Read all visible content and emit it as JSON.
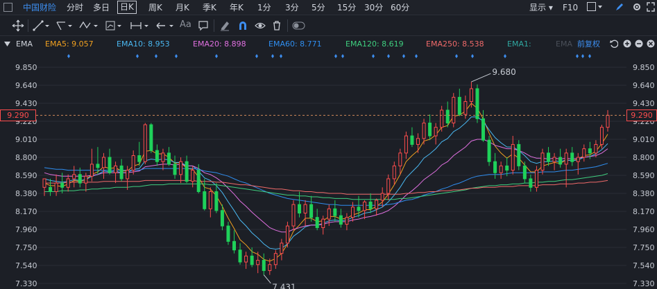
{
  "periods": [
    {
      "label": "中国财险",
      "brand": true
    },
    {
      "label": "分时"
    },
    {
      "label": "多日"
    },
    {
      "label": "日K",
      "active": true
    },
    {
      "label": "周K"
    },
    {
      "label": "月K"
    },
    {
      "label": "季K"
    },
    {
      "label": "年K"
    },
    {
      "label": "1分"
    },
    {
      "label": "3分"
    },
    {
      "label": "5分"
    },
    {
      "label": "15分"
    },
    {
      "label": "30分"
    },
    {
      "label": "60分"
    }
  ],
  "topright": {
    "display": "显示",
    "f10": "F10"
  },
  "toolbar": {
    "text_tool": "Aa"
  },
  "legend": {
    "indicator": "EMA",
    "items": [
      {
        "text": "EMA5: 9.057",
        "color": "#f0a020"
      },
      {
        "text": "EMA10: 8.953",
        "color": "#4ab7f0"
      },
      {
        "text": "EMA20: 8.898",
        "color": "#e070e0"
      },
      {
        "text": "EMA60: 8.771",
        "color": "#2f8ef0"
      },
      {
        "text": "EMA120: 8.619",
        "color": "#3fcf7f"
      },
      {
        "text": "EMA250: 8.538",
        "color": "#f06a6a"
      },
      {
        "text": "EMA1:",
        "color": "#2fa7a0"
      },
      {
        "text": "EMA",
        "color": "#4a4f59"
      }
    ],
    "adjust": "前复权"
  },
  "colors": {
    "up": "#ff4d4d",
    "down": "#1fd15a",
    "grid": "#2a2e37",
    "axis_text": "#c8ccd4",
    "cursor": "#ff4d4d"
  },
  "chart_data": {
    "type": "candlestick",
    "yticks": [
      9.85,
      9.64,
      9.43,
      9.22,
      9.01,
      8.8,
      8.59,
      8.38,
      8.17,
      7.96,
      7.75,
      7.54,
      7.33
    ],
    "ylim": [
      7.33,
      9.85
    ],
    "current_price": "9.290",
    "high_label": "9.680",
    "low_label": "7.431",
    "candles": [
      [
        8.45,
        8.55,
        8.35,
        8.55
      ],
      [
        8.45,
        8.55,
        8.35,
        8.4
      ],
      [
        8.4,
        8.6,
        8.35,
        8.5
      ],
      [
        8.5,
        8.62,
        8.38,
        8.45
      ],
      [
        8.45,
        8.6,
        8.4,
        8.55
      ],
      [
        8.55,
        8.7,
        8.45,
        8.6
      ],
      [
        8.6,
        8.68,
        8.45,
        8.5
      ],
      [
        8.5,
        8.62,
        8.4,
        8.58
      ],
      [
        8.58,
        8.9,
        8.52,
        8.72
      ],
      [
        8.72,
        8.92,
        8.6,
        8.68
      ],
      [
        8.68,
        8.85,
        8.55,
        8.8
      ],
      [
        8.8,
        8.9,
        8.6,
        8.62
      ],
      [
        8.62,
        8.75,
        8.5,
        8.7
      ],
      [
        8.7,
        8.78,
        8.52,
        8.55
      ],
      [
        8.55,
        8.7,
        8.42,
        8.65
      ],
      [
        8.65,
        8.88,
        8.6,
        8.82
      ],
      [
        8.82,
        8.98,
        8.7,
        8.75
      ],
      [
        8.75,
        9.2,
        8.72,
        9.18
      ],
      [
        9.18,
        9.2,
        8.85,
        8.88
      ],
      [
        8.88,
        8.95,
        8.7,
        8.75
      ],
      [
        8.75,
        8.9,
        8.65,
        8.85
      ],
      [
        8.85,
        8.92,
        8.7,
        8.72
      ],
      [
        8.72,
        8.82,
        8.55,
        8.6
      ],
      [
        8.6,
        8.8,
        8.5,
        8.75
      ],
      [
        8.75,
        8.82,
        8.5,
        8.52
      ],
      [
        8.52,
        8.7,
        8.45,
        8.65
      ],
      [
        8.65,
        8.72,
        8.38,
        8.4
      ],
      [
        8.4,
        8.55,
        8.18,
        8.2
      ],
      [
        8.2,
        8.45,
        8.1,
        8.4
      ],
      [
        8.4,
        8.5,
        8.15,
        8.18
      ],
      [
        8.18,
        8.25,
        7.95,
        8.0
      ],
      [
        8.0,
        8.05,
        7.78,
        7.82
      ],
      [
        7.82,
        7.95,
        7.68,
        7.72
      ],
      [
        7.72,
        7.8,
        7.55,
        7.58
      ],
      [
        7.58,
        7.7,
        7.5,
        7.65
      ],
      [
        7.65,
        7.75,
        7.52,
        7.55
      ],
      [
        7.55,
        7.7,
        7.45,
        7.6
      ],
      [
        7.6,
        7.68,
        7.43,
        7.48
      ],
      [
        7.48,
        7.62,
        7.43,
        7.55
      ],
      [
        7.55,
        7.72,
        7.5,
        7.68
      ],
      [
        7.68,
        7.85,
        7.6,
        7.8
      ],
      [
        7.8,
        8.05,
        7.75,
        8.0
      ],
      [
        8.0,
        8.3,
        7.95,
        8.25
      ],
      [
        8.25,
        8.4,
        8.1,
        8.15
      ],
      [
        8.15,
        8.3,
        8.0,
        8.25
      ],
      [
        8.25,
        8.35,
        8.05,
        8.1
      ],
      [
        8.1,
        8.2,
        7.95,
        7.98
      ],
      [
        7.98,
        8.12,
        7.9,
        8.08
      ],
      [
        8.08,
        8.25,
        8.0,
        8.2
      ],
      [
        8.2,
        8.3,
        8.05,
        8.12
      ],
      [
        8.12,
        8.2,
        7.98,
        8.02
      ],
      [
        8.02,
        8.15,
        7.95,
        8.1
      ],
      [
        8.1,
        8.28,
        8.05,
        8.22
      ],
      [
        8.22,
        8.35,
        8.1,
        8.18
      ],
      [
        8.18,
        8.3,
        8.08,
        8.28
      ],
      [
        8.28,
        8.38,
        8.15,
        8.2
      ],
      [
        8.2,
        8.32,
        8.12,
        8.3
      ],
      [
        8.3,
        8.45,
        8.22,
        8.38
      ],
      [
        8.38,
        8.6,
        8.3,
        8.55
      ],
      [
        8.55,
        8.75,
        8.48,
        8.7
      ],
      [
        8.7,
        8.9,
        8.6,
        8.85
      ],
      [
        8.85,
        9.1,
        8.78,
        9.05
      ],
      [
        9.05,
        9.15,
        8.92,
        8.95
      ],
      [
        8.95,
        9.08,
        8.85,
        9.02
      ],
      [
        9.02,
        9.25,
        8.95,
        9.2
      ],
      [
        9.2,
        9.3,
        9.0,
        9.05
      ],
      [
        9.05,
        9.2,
        8.95,
        9.15
      ],
      [
        9.15,
        9.4,
        9.1,
        9.35
      ],
      [
        9.35,
        9.45,
        9.15,
        9.2
      ],
      [
        9.2,
        9.55,
        9.15,
        9.5
      ],
      [
        9.5,
        9.6,
        9.28,
        9.3
      ],
      [
        9.3,
        9.52,
        9.25,
        9.45
      ],
      [
        9.45,
        9.68,
        9.38,
        9.6
      ],
      [
        9.6,
        9.65,
        9.2,
        9.25
      ],
      [
        9.25,
        9.35,
        8.98,
        9.0
      ],
      [
        9.0,
        9.05,
        8.7,
        8.75
      ],
      [
        8.75,
        8.85,
        8.55,
        8.62
      ],
      [
        8.62,
        8.75,
        8.55,
        8.7
      ],
      [
        8.7,
        8.8,
        8.58,
        8.65
      ],
      [
        8.65,
        9.05,
        8.6,
        8.95
      ],
      [
        8.95,
        9.0,
        8.65,
        8.7
      ],
      [
        8.7,
        8.75,
        8.5,
        8.55
      ],
      [
        8.55,
        8.6,
        8.4,
        8.45
      ],
      [
        8.45,
        8.7,
        8.4,
        8.65
      ],
      [
        8.65,
        8.9,
        8.6,
        8.85
      ],
      [
        8.85,
        8.92,
        8.7,
        8.75
      ],
      [
        8.75,
        8.85,
        8.65,
        8.8
      ],
      [
        8.8,
        8.9,
        8.68,
        8.72
      ],
      [
        8.72,
        8.9,
        8.45,
        8.85
      ],
      [
        8.85,
        8.92,
        8.7,
        8.75
      ],
      [
        8.75,
        8.85,
        8.6,
        8.8
      ],
      [
        8.8,
        8.95,
        8.75,
        8.9
      ],
      [
        8.9,
        8.98,
        8.78,
        8.85
      ],
      [
        8.85,
        9.0,
        8.8,
        8.95
      ],
      [
        8.95,
        9.18,
        8.9,
        9.15
      ],
      [
        9.15,
        9.35,
        9.1,
        9.29
      ]
    ],
    "ema": [
      {
        "name": "EMA5",
        "color": "#f0a020",
        "values": [
          8.5,
          8.47,
          8.47,
          8.46,
          8.49,
          8.53,
          8.52,
          8.54,
          8.6,
          8.63,
          8.69,
          8.67,
          8.68,
          8.64,
          8.64,
          8.7,
          8.72,
          8.87,
          8.88,
          8.84,
          8.84,
          8.8,
          8.73,
          8.74,
          8.67,
          8.66,
          8.57,
          8.45,
          8.43,
          8.35,
          8.23,
          8.09,
          7.97,
          7.84,
          7.78,
          7.7,
          7.67,
          7.61,
          7.59,
          7.62,
          7.68,
          7.79,
          7.94,
          8.01,
          8.09,
          8.09,
          8.05,
          8.06,
          8.11,
          8.11,
          8.08,
          8.09,
          8.13,
          8.15,
          8.19,
          8.19,
          8.23,
          8.28,
          8.37,
          8.48,
          8.6,
          8.75,
          8.82,
          8.88,
          8.99,
          9.01,
          9.06,
          9.15,
          9.17,
          9.28,
          9.29,
          9.34,
          9.43,
          9.37,
          9.25,
          9.08,
          8.93,
          8.85,
          8.79,
          8.84,
          8.79,
          8.71,
          8.63,
          8.63,
          8.7,
          8.72,
          8.74,
          8.73,
          8.77,
          8.76,
          8.78,
          8.82,
          8.83,
          8.87,
          8.96,
          9.07
        ]
      },
      {
        "name": "EMA10",
        "color": "#4ab7f0",
        "values": [
          8.55,
          8.53,
          8.52,
          8.51,
          8.52,
          8.54,
          8.53,
          8.54,
          8.58,
          8.6,
          8.64,
          8.63,
          8.64,
          8.62,
          8.62,
          8.66,
          8.67,
          8.76,
          8.78,
          8.77,
          8.78,
          8.77,
          8.74,
          8.74,
          8.7,
          8.7,
          8.64,
          8.56,
          8.53,
          8.47,
          8.39,
          8.28,
          8.18,
          8.07,
          8.0,
          7.92,
          7.86,
          7.79,
          7.74,
          7.73,
          7.74,
          7.79,
          7.88,
          7.93,
          7.99,
          8.01,
          8.01,
          8.03,
          8.06,
          8.07,
          8.06,
          8.07,
          8.1,
          8.12,
          8.15,
          8.16,
          8.19,
          8.22,
          8.28,
          8.36,
          8.45,
          8.56,
          8.63,
          8.7,
          8.79,
          8.84,
          8.9,
          8.98,
          9.02,
          9.1,
          9.14,
          9.2,
          9.27,
          9.27,
          9.22,
          9.12,
          9.03,
          8.97,
          8.92,
          8.92,
          8.88,
          8.82,
          8.75,
          8.73,
          8.75,
          8.75,
          8.76,
          8.75,
          8.77,
          8.76,
          8.77,
          8.8,
          8.81,
          8.84,
          8.89,
          8.96
        ]
      },
      {
        "name": "EMA20",
        "color": "#e070e0",
        "values": [
          8.62,
          8.6,
          8.59,
          8.58,
          8.58,
          8.58,
          8.58,
          8.58,
          8.59,
          8.6,
          8.62,
          8.62,
          8.62,
          8.62,
          8.62,
          8.63,
          8.64,
          8.69,
          8.7,
          8.71,
          8.72,
          8.72,
          8.71,
          8.72,
          8.7,
          8.7,
          8.67,
          8.62,
          8.6,
          8.56,
          8.51,
          8.44,
          8.37,
          8.29,
          8.23,
          8.16,
          8.1,
          8.04,
          7.98,
          7.95,
          7.93,
          7.93,
          7.96,
          7.98,
          8.0,
          8.01,
          8.01,
          8.02,
          8.04,
          8.05,
          8.05,
          8.05,
          8.07,
          8.08,
          8.1,
          8.11,
          8.13,
          8.15,
          8.18,
          8.23,
          8.29,
          8.36,
          8.41,
          8.47,
          8.54,
          8.59,
          8.64,
          8.71,
          8.75,
          8.82,
          8.87,
          8.92,
          8.99,
          9.01,
          9.01,
          8.98,
          8.94,
          8.92,
          8.9,
          8.9,
          8.88,
          8.85,
          8.81,
          8.79,
          8.79,
          8.78,
          8.79,
          8.78,
          8.79,
          8.78,
          8.79,
          8.8,
          8.81,
          8.82,
          8.85,
          8.9
        ]
      },
      {
        "name": "EMA60",
        "color": "#2f8ef0",
        "values": [
          8.68,
          8.67,
          8.66,
          8.66,
          8.65,
          8.65,
          8.65,
          8.65,
          8.65,
          8.65,
          8.65,
          8.65,
          8.65,
          8.65,
          8.65,
          8.65,
          8.65,
          8.67,
          8.67,
          8.67,
          8.67,
          8.67,
          8.67,
          8.67,
          8.67,
          8.67,
          8.66,
          8.64,
          8.63,
          8.62,
          8.6,
          8.58,
          8.55,
          8.52,
          8.5,
          8.47,
          8.44,
          8.41,
          8.38,
          8.36,
          8.34,
          8.32,
          8.31,
          8.3,
          8.29,
          8.28,
          8.27,
          8.26,
          8.25,
          8.25,
          8.24,
          8.24,
          8.24,
          8.24,
          8.24,
          8.24,
          8.24,
          8.24,
          8.25,
          8.26,
          8.28,
          8.3,
          8.31,
          8.33,
          8.36,
          8.38,
          8.4,
          8.43,
          8.45,
          8.48,
          8.5,
          8.53,
          8.56,
          8.58,
          8.59,
          8.6,
          8.6,
          8.6,
          8.61,
          8.62,
          8.62,
          8.62,
          8.62,
          8.62,
          8.63,
          8.63,
          8.63,
          8.64,
          8.65,
          8.65,
          8.66,
          8.67,
          8.68,
          8.69,
          8.71,
          8.73
        ]
      },
      {
        "name": "EMA120",
        "color": "#3fcf7f",
        "values": [
          8.4,
          8.4,
          8.4,
          8.41,
          8.41,
          8.41,
          8.42,
          8.42,
          8.43,
          8.43,
          8.44,
          8.44,
          8.45,
          8.45,
          8.45,
          8.46,
          8.46,
          8.47,
          8.48,
          8.48,
          8.48,
          8.49,
          8.49,
          8.49,
          8.49,
          8.49,
          8.49,
          8.49,
          8.48,
          8.48,
          8.47,
          8.46,
          8.45,
          8.44,
          8.43,
          8.42,
          8.41,
          8.4,
          8.39,
          8.38,
          8.37,
          8.36,
          8.36,
          8.35,
          8.35,
          8.34,
          8.34,
          8.33,
          8.33,
          8.32,
          8.32,
          8.32,
          8.31,
          8.31,
          8.31,
          8.31,
          8.31,
          8.31,
          8.31,
          8.31,
          8.32,
          8.32,
          8.33,
          8.34,
          8.35,
          8.36,
          8.37,
          8.38,
          8.39,
          8.4,
          8.41,
          8.42,
          8.44,
          8.45,
          8.46,
          8.47,
          8.47,
          8.48,
          8.48,
          8.49,
          8.49,
          8.5,
          8.5,
          8.51,
          8.51,
          8.52,
          8.52,
          8.53,
          8.54,
          8.54,
          8.55,
          8.56,
          8.57,
          8.58,
          8.59,
          8.61
        ]
      },
      {
        "name": "EMA250",
        "color": "#f06a6a",
        "values": [
          8.5,
          8.5,
          8.5,
          8.5,
          8.51,
          8.51,
          8.51,
          8.51,
          8.51,
          8.51,
          8.52,
          8.52,
          8.52,
          8.52,
          8.52,
          8.52,
          8.52,
          8.53,
          8.53,
          8.53,
          8.53,
          8.53,
          8.53,
          8.53,
          8.53,
          8.53,
          8.52,
          8.52,
          8.52,
          8.51,
          8.51,
          8.5,
          8.49,
          8.48,
          8.48,
          8.47,
          8.46,
          8.45,
          8.44,
          8.43,
          8.43,
          8.42,
          8.41,
          8.41,
          8.4,
          8.4,
          8.39,
          8.39,
          8.38,
          8.38,
          8.38,
          8.37,
          8.37,
          8.37,
          8.37,
          8.37,
          8.37,
          8.37,
          8.37,
          8.37,
          8.37,
          8.38,
          8.38,
          8.39,
          8.39,
          8.4,
          8.4,
          8.41,
          8.41,
          8.42,
          8.42,
          8.43,
          8.44,
          8.44,
          8.45,
          8.45,
          8.45,
          8.46,
          8.46,
          8.46,
          8.47,
          8.47,
          8.47,
          8.47,
          8.48,
          8.48,
          8.48,
          8.49,
          8.49,
          8.49,
          8.5,
          8.5,
          8.51,
          8.51,
          8.52,
          8.53
        ]
      }
    ]
  }
}
